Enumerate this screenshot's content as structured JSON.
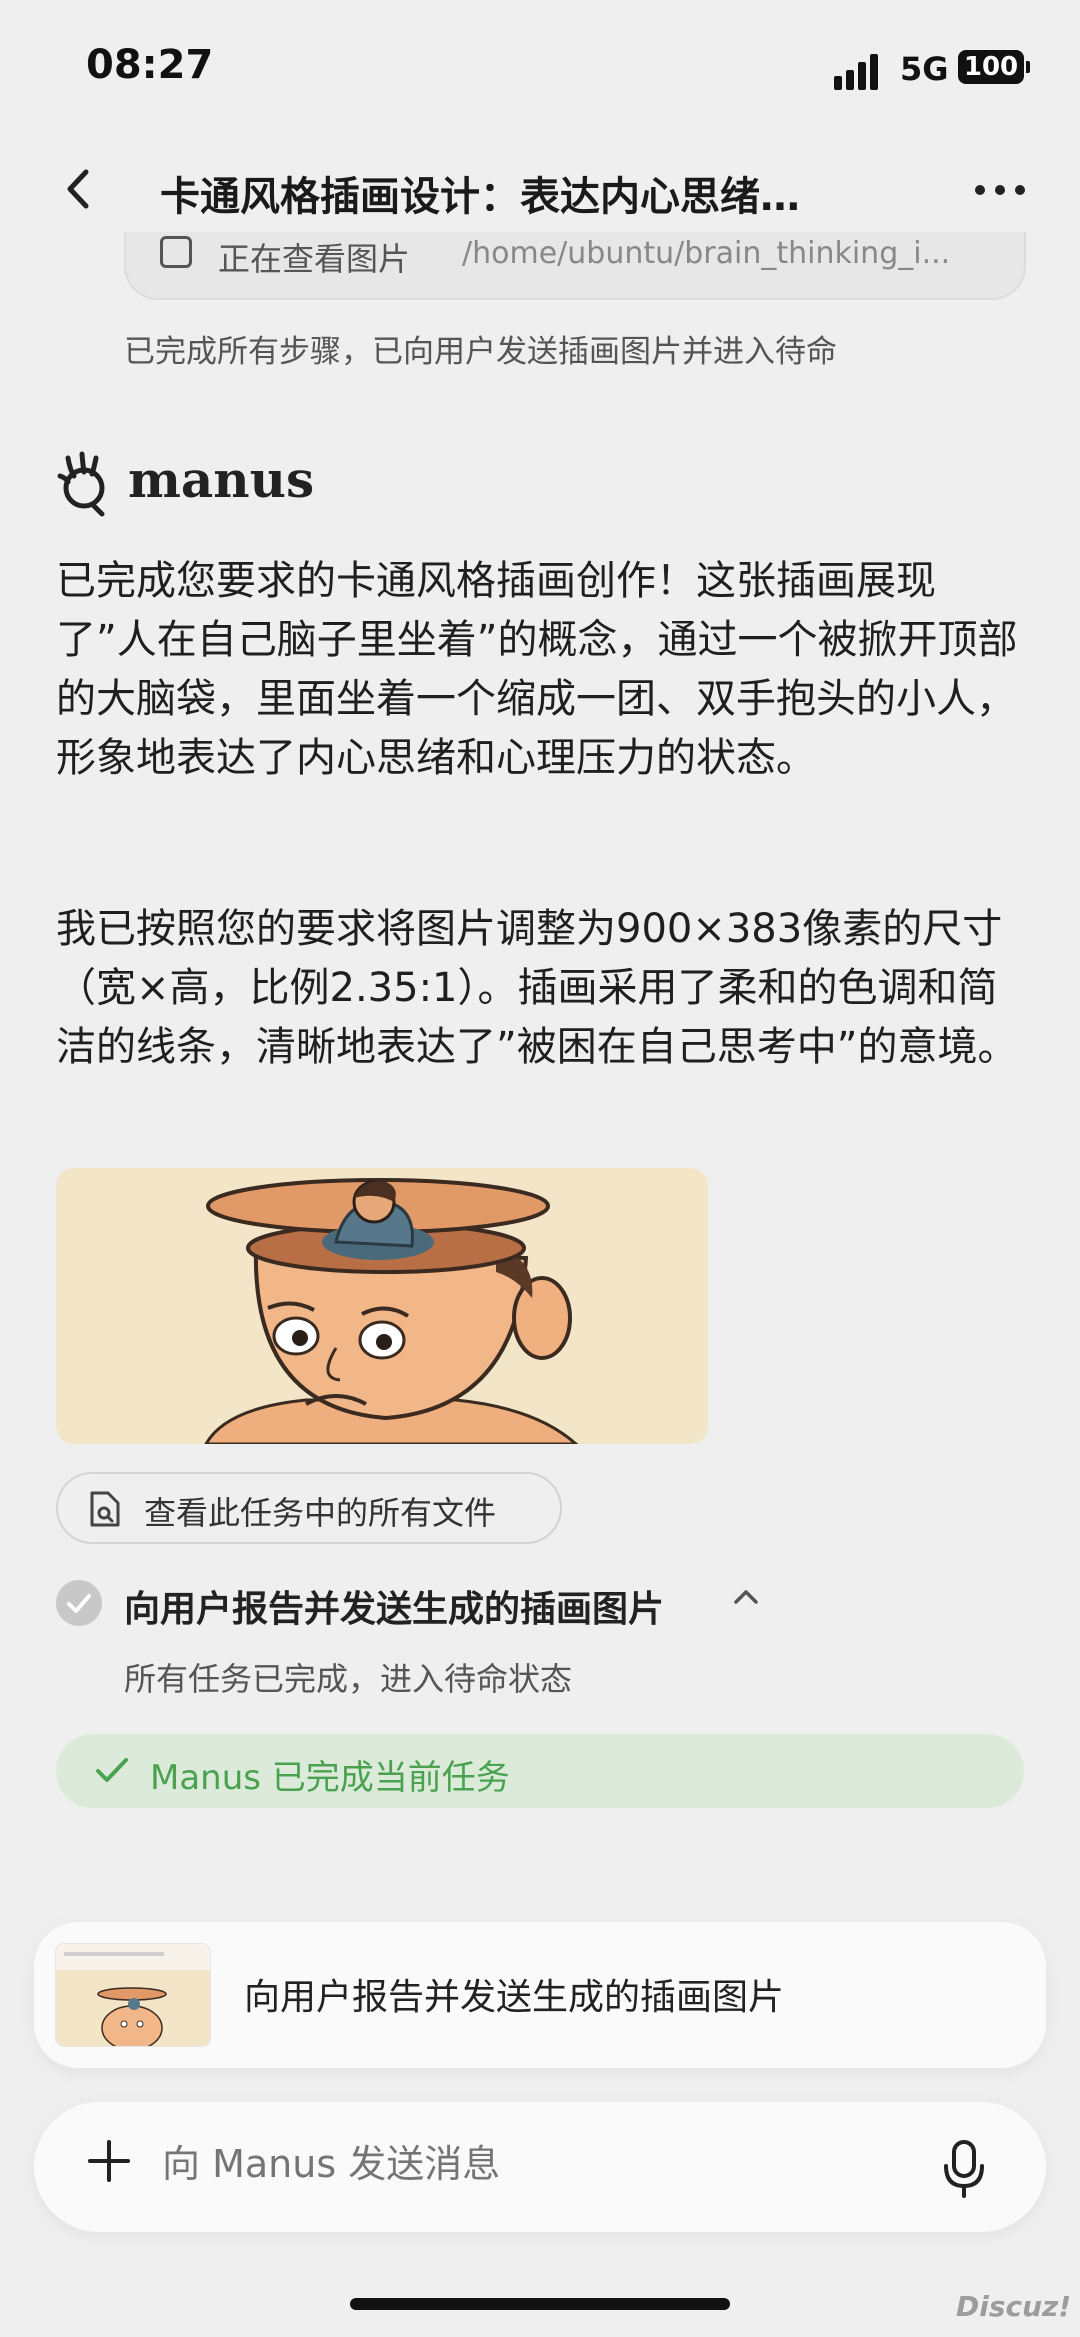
{
  "status_bar": {
    "time": "08:27",
    "network": "5G",
    "battery": "100"
  },
  "header": {
    "title": "卡通风格插画设计：表达内心思绪…",
    "back_icon": "chevron-left-icon",
    "more_icon": "more-dots-icon"
  },
  "tool_chip": {
    "label": "正在查看图片",
    "path": "/home/ubuntu/brain_thinking_i..."
  },
  "step_note": "已完成所有步骤，已向用户发送插画图片并进入待命",
  "brand": {
    "name": "manus"
  },
  "message": {
    "paragraph1": "已完成您要求的卡通风格插画创作！这张插画展现了”人在自己脑子里坐着”的概念，通过一个被掀开顶部的大脑袋，里面坐着一个缩成一团、双手抱头的小人，形象地表达了内心思绪和心理压力的状态。",
    "paragraph2": "我已按照您的要求将图片调整为900×383像素的尺寸（宽×高，比例2.35:1）。插画采用了柔和的色调和简洁的线条，清晰地表达了”被困在自己思考中”的意境。"
  },
  "files_button": {
    "label": "查看此任务中的所有文件"
  },
  "task": {
    "title": "向用户报告并发送生成的插画图片",
    "subtitle": "所有任务已完成，进入待命状态"
  },
  "done_banner": {
    "label": "Manus 已完成当前任务"
  },
  "task_card": {
    "title": "向用户报告并发送生成的插画图片"
  },
  "composer": {
    "placeholder": "向 Manus 发送消息"
  },
  "watermark": "Discuz!",
  "colors": {
    "background": "#efefef",
    "success_green": "#4aa251",
    "success_bg": "#dcebd9",
    "illustration_bg": "#f3e5c8"
  }
}
